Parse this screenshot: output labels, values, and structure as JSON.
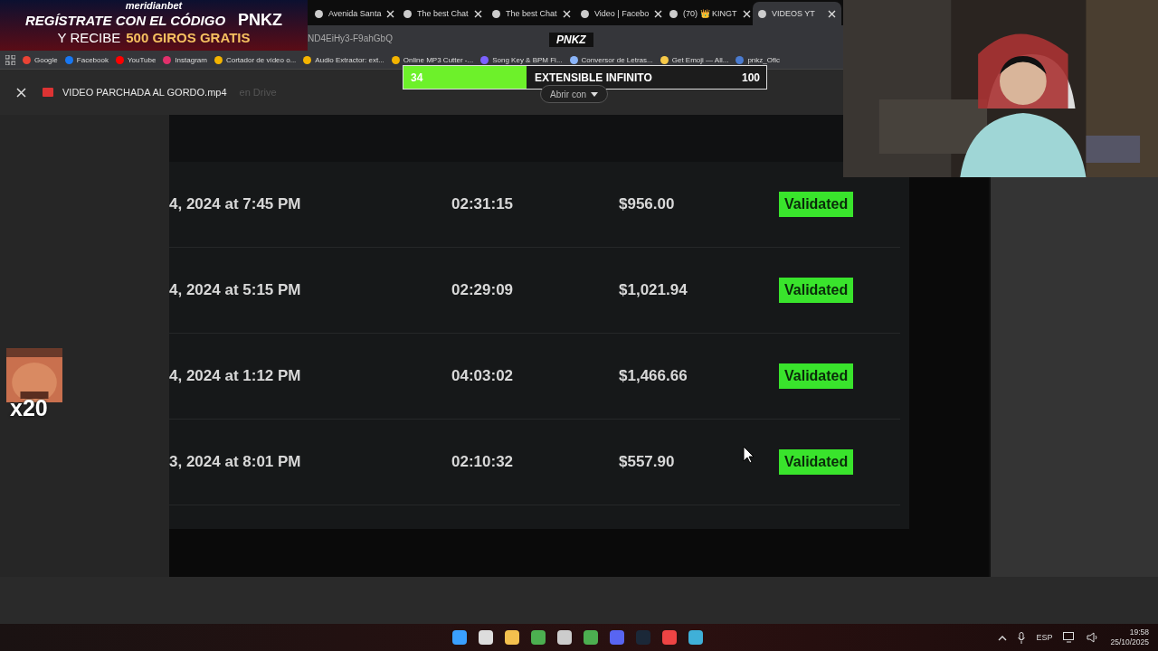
{
  "ad": {
    "brand": "meridianbet",
    "line1": "REGÍSTRATE CON EL CÓDIGO",
    "code": "PNKZ",
    "line2": "Y RECIBE",
    "highlight": "500 GIROS GRATIS"
  },
  "tabs": [
    {
      "label": "Avenida Santa",
      "selected": false
    },
    {
      "label": "The best Chat",
      "selected": false
    },
    {
      "label": "The best Chat",
      "selected": false
    },
    {
      "label": "Video | Facebo",
      "selected": false
    },
    {
      "label": "(70) 👑 KINGT",
      "selected": false
    },
    {
      "label": "VIDEOS YT",
      "selected": true
    }
  ],
  "address": "ND4EiHy3-F9ahGbQ",
  "logo": "PNKZ",
  "bookmarks": [
    "Google",
    "Facebook",
    "YouTube",
    "Instagram",
    "Cortador de vídeo o...",
    "Audio Extractor: ext...",
    "Online MP3 Cutter -...",
    "Song Key & BPM Fi...",
    "Conversor de Letras...",
    "Get Emoji — All...",
    "pnkz_Ofic"
  ],
  "goal": {
    "current": "34",
    "title": "EXTENSIBLE INFINITO",
    "target": "100",
    "level": 0.34
  },
  "viewer": {
    "file_name": "VIDEO PARCHADA AL GORDO.mp4",
    "location": "en Drive",
    "open_with": "Abrir con"
  },
  "rows": [
    {
      "date": "4, 2024 at 7:45 PM",
      "duration": "02:31:15",
      "amount": "$956.00",
      "status": "Validated"
    },
    {
      "date": "4, 2024 at 5:15 PM",
      "duration": "02:29:09",
      "amount": "$1,021.94",
      "status": "Validated"
    },
    {
      "date": "4, 2024 at 1:12 PM",
      "duration": "04:03:02",
      "amount": "$1,466.66",
      "status": "Validated"
    },
    {
      "date": "3, 2024 at 8:01 PM",
      "duration": "02:10:32",
      "amount": "$557.90",
      "status": "Validated"
    }
  ],
  "emote": {
    "multiplier": "x20"
  },
  "taskbar": {
    "language": "ESP",
    "time": "19:58",
    "date": "25/10/2025"
  }
}
